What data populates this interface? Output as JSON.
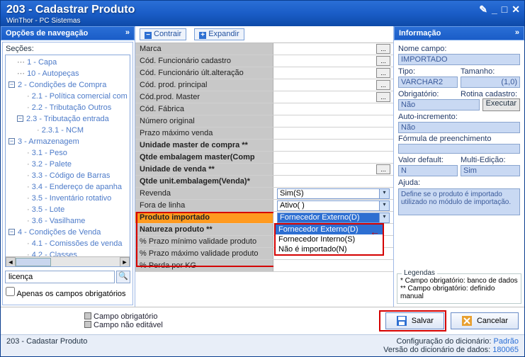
{
  "window": {
    "title": "203 - Cadastrar  Produto",
    "subtitle": "WinThor - PC Sistemas"
  },
  "left": {
    "header": "Opções de navegação",
    "sections_label": "Seções:",
    "tree": [
      {
        "t": "1 - Capa",
        "lvl": 1
      },
      {
        "t": "10 - Autopeças",
        "lvl": 1
      },
      {
        "t": "2 - Condições de Compra",
        "lvl": 0,
        "exp": true
      },
      {
        "t": "2.1 - Política comercial com",
        "lvl": 2
      },
      {
        "t": "2.2 - Tributação Outros",
        "lvl": 2
      },
      {
        "t": "2.3 - Tributação entrada",
        "lvl": 1,
        "exp": true
      },
      {
        "t": "2.3.1 - NCM",
        "lvl": 3
      },
      {
        "t": "3 - Armazenagem",
        "lvl": 0,
        "exp": true
      },
      {
        "t": "3.1 - Peso",
        "lvl": 2
      },
      {
        "t": "3.2 - Palete",
        "lvl": 2
      },
      {
        "t": "3.3 - Código de Barras",
        "lvl": 2
      },
      {
        "t": "3.4 - Endereço de apanha",
        "lvl": 2
      },
      {
        "t": "3.5 - Inventário rotativo",
        "lvl": 2
      },
      {
        "t": "3.5 - Lote",
        "lvl": 2
      },
      {
        "t": "3.6 - Vasilhame",
        "lvl": 2
      },
      {
        "t": "4 - Condições de Venda",
        "lvl": 0,
        "exp": true
      },
      {
        "t": "4.1 - Comissões de venda",
        "lvl": 2
      },
      {
        "t": "4.2 - Classes",
        "lvl": 2
      }
    ],
    "search_value": "licença",
    "only_required": "Apenas os campos obrigatórios"
  },
  "center": {
    "contrair": "Contrair",
    "expandir": "Expandir",
    "fields": [
      {
        "label": "Marca",
        "btn": true
      },
      {
        "label": "Cód. Funcionário cadastro",
        "btn": true
      },
      {
        "label": "Cód. Funcionário últ.alteração",
        "btn": true
      },
      {
        "label": "Cód. prod. principal",
        "btn": true
      },
      {
        "label": "Cód.prod. Master",
        "btn": true
      },
      {
        "label": "Cód. Fábrica"
      },
      {
        "label": "Número original"
      },
      {
        "label": "Prazo máximo venda"
      },
      {
        "label": "Unidade master de compra **",
        "bold": true
      },
      {
        "label": "Qtde embalagem master(Comp",
        "bold": true
      },
      {
        "label": "Unidade de venda **",
        "bold": true,
        "btn": true
      },
      {
        "label": "Qtde unit.embalagem(Venda)*",
        "bold": true
      },
      {
        "label": "Revenda",
        "combo": "Sim(S)"
      },
      {
        "label": "Fora de linha",
        "combo": "Ativo( )"
      },
      {
        "label": "Produto importado",
        "hl": true,
        "combo": "Fornecedor Externo(D)",
        "dropdown": true
      },
      {
        "label": "Natureza produto **",
        "bold": true
      },
      {
        "label": "% Prazo mínimo validade produto"
      },
      {
        "label": "% Prazo máximo validade produto"
      },
      {
        "label": "% Perda por KG"
      }
    ],
    "options": [
      "Fornecedor Externo(D)",
      "Fornecedor Interno(S)",
      "Não é importado(N)"
    ]
  },
  "right": {
    "header": "Informação",
    "nome_campo_lbl": "Nome campo:",
    "nome_campo": "IMPORTADO",
    "tipo_lbl": "Tipo:",
    "tipo": "VARCHAR2",
    "tam_lbl": "Tamanho:",
    "tam": "(1,0)",
    "obrig_lbl": "Obrigatório:",
    "rotina_lbl": "Rotina cadastro:",
    "obrig": "Não",
    "executar": "Executar",
    "auto_lbl": "Auto-incremento:",
    "auto": "Não",
    "formula_lbl": "Fórmula de preenchimento",
    "formula": "",
    "default_lbl": "Valor default:",
    "multi_lbl": "Multi-Edição:",
    "default": "N",
    "multi": "Sim",
    "ajuda_lbl": "Ajuda:",
    "ajuda": "Define se o produto é importado utilizado no módulo de importação.",
    "legend_title": "Legendas",
    "leg1": "* Campo obrigatório: banco de dados",
    "leg2": "** Campo obrigatório: definido manual"
  },
  "bottom": {
    "campo_obrig": "Campo obrigatório",
    "campo_nao": "Campo não editável",
    "salvar": "Salvar",
    "cancelar": "Cancelar"
  },
  "status": {
    "left": "203 - Cadastar  Produto",
    "conf": "Configuração do dicionário: ",
    "conf_v": "Padrão",
    "ver": "Versão do dicionário de dados: ",
    "ver_v": "180065"
  }
}
